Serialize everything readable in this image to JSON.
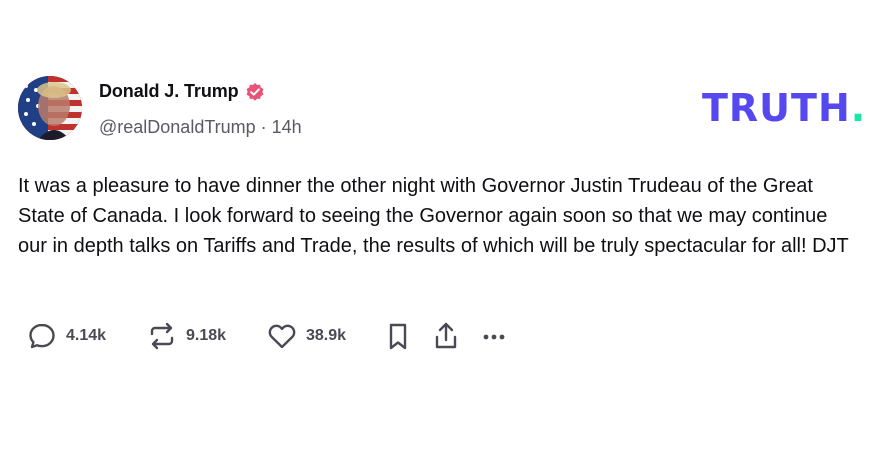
{
  "post": {
    "author": {
      "display_name": "Donald J. Trump",
      "handle_time": "@realDonaldTrump · 14h",
      "avatar_icon": "profile-avatar",
      "verified_icon": "verified-badge-icon",
      "verified_color": "#e8527a"
    },
    "brand": {
      "name": "TRUTH",
      "dot": ".",
      "color": "#5448ee",
      "dot_color": "#17e8a5"
    },
    "body": "It was a pleasure to have dinner the other night with Governor Justin Trudeau of the Great State of Canada. I look forward to seeing the Governor again soon so that we may continue our in depth talks on Tariffs and Trade, the results of which will be truly spectacular for all! DJT",
    "actions": {
      "replies": {
        "count": "4.14k",
        "icon": "reply-bubble-icon"
      },
      "retruths": {
        "count": "9.18k",
        "icon": "retruth-icon"
      },
      "likes": {
        "count": "38.9k",
        "icon": "heart-icon"
      },
      "bookmark": {
        "icon": "bookmark-icon"
      },
      "share": {
        "icon": "share-icon"
      },
      "more": {
        "icon": "more-dots-icon"
      }
    }
  }
}
